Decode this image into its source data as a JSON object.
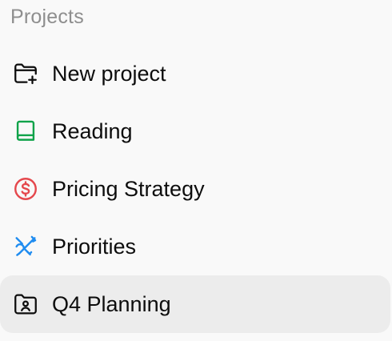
{
  "section": {
    "title": "Projects"
  },
  "items": [
    {
      "label": "New project",
      "icon": "folder-plus-icon",
      "color": "#0d0d0d",
      "active": false
    },
    {
      "label": "Reading",
      "icon": "book-icon",
      "color": "#10a34a",
      "active": false
    },
    {
      "label": "Pricing Strategy",
      "icon": "dollar-circle-icon",
      "color": "#e5484d",
      "active": false
    },
    {
      "label": "Priorities",
      "icon": "compass-drafting-icon",
      "color": "#1f8cf0",
      "active": false
    },
    {
      "label": "Q4 Planning",
      "icon": "folder-user-icon",
      "color": "#0d0d0d",
      "active": true
    }
  ]
}
